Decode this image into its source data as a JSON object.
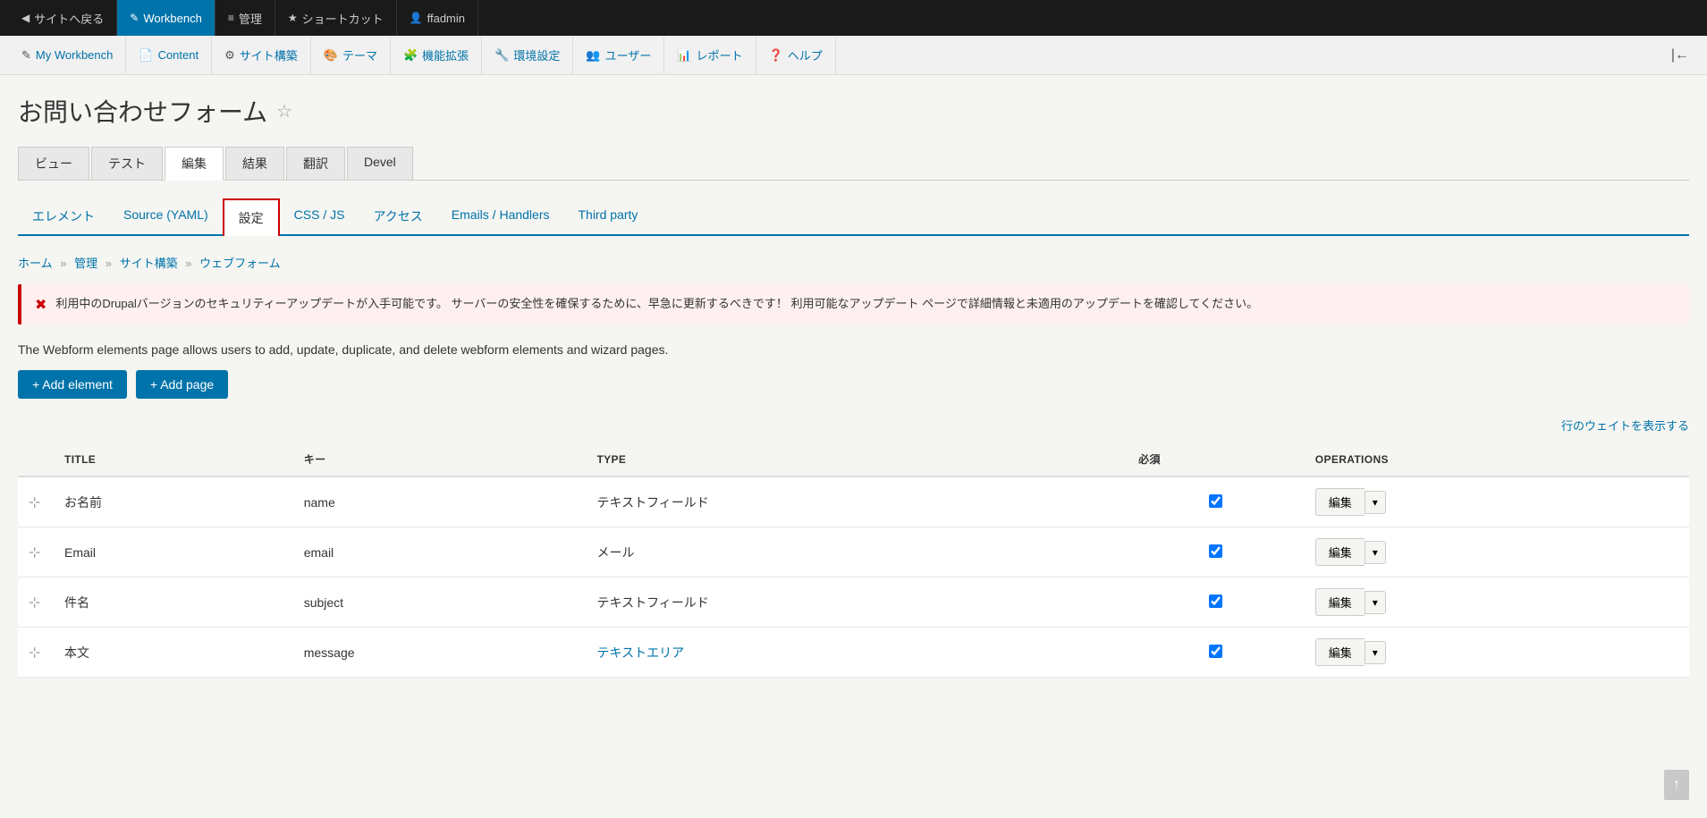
{
  "admin_bar": {
    "items": [
      {
        "id": "back-to-site",
        "label": "サイトへ戻る",
        "icon": "◀"
      },
      {
        "id": "workbench",
        "label": "Workbench",
        "icon": "✎",
        "active": true
      },
      {
        "id": "admin",
        "label": "管理",
        "icon": "≡"
      },
      {
        "id": "shortcuts",
        "label": "ショートカット",
        "icon": "★"
      },
      {
        "id": "user",
        "label": "ffadmin",
        "icon": "👤"
      }
    ]
  },
  "secondary_nav": {
    "items": [
      {
        "id": "my-workbench",
        "label": "My Workbench",
        "icon": "✎"
      },
      {
        "id": "content",
        "label": "Content",
        "icon": "📄"
      },
      {
        "id": "site-structure",
        "label": "サイト構築",
        "icon": "⚙"
      },
      {
        "id": "theme",
        "label": "テーマ",
        "icon": "🔑"
      },
      {
        "id": "extensions",
        "label": "機能拡張",
        "icon": "🧩"
      },
      {
        "id": "environment",
        "label": "環境設定",
        "icon": "🔧"
      },
      {
        "id": "users",
        "label": "ユーザー",
        "icon": "👥"
      },
      {
        "id": "reports",
        "label": "レポート",
        "icon": "📊"
      },
      {
        "id": "help",
        "label": "ヘルプ",
        "icon": "❓"
      }
    ]
  },
  "page": {
    "title": "お問い合わせフォーム",
    "star_tooltip": "お気に入りに追加"
  },
  "primary_tabs": [
    {
      "id": "view",
      "label": "ビュー",
      "active": false
    },
    {
      "id": "test",
      "label": "テスト",
      "active": false
    },
    {
      "id": "edit",
      "label": "編集",
      "active": true
    },
    {
      "id": "results",
      "label": "結果",
      "active": false
    },
    {
      "id": "translate",
      "label": "翻訳",
      "active": false
    },
    {
      "id": "devel",
      "label": "Devel",
      "active": false
    }
  ],
  "secondary_tabs": [
    {
      "id": "elements",
      "label": "エレメント",
      "active": false
    },
    {
      "id": "source-yaml",
      "label": "Source (YAML)",
      "active": false
    },
    {
      "id": "settings",
      "label": "設定",
      "active": true
    },
    {
      "id": "css-js",
      "label": "CSS / JS",
      "active": false
    },
    {
      "id": "access",
      "label": "アクセス",
      "active": false
    },
    {
      "id": "emails-handlers",
      "label": "Emails / Handlers",
      "active": false
    },
    {
      "id": "third-party",
      "label": "Third party",
      "active": false
    }
  ],
  "breadcrumb": {
    "items": [
      {
        "label": "ホーム",
        "href": "#"
      },
      {
        "label": "管理",
        "href": "#"
      },
      {
        "label": "サイト構築",
        "href": "#"
      },
      {
        "label": "ウェブフォーム",
        "href": "#"
      }
    ]
  },
  "alert": {
    "text": "利用中のDrupalバージョンのセキュリティーアップデートが入手可能です。 サーバーの安全性を確保するために、早急に更新するべきです！ 利用可能なアップデート ページで詳細情報と未適用のアップデートを確認してください。"
  },
  "description": "The Webform elements page allows users to add, update, duplicate, and delete webform elements and wizard pages.",
  "buttons": {
    "add_element": "+ Add element",
    "add_page": "+ Add page"
  },
  "show_weights_link": "行のウェイトを表示する",
  "table": {
    "columns": [
      {
        "id": "title",
        "label": "TITLE"
      },
      {
        "id": "key",
        "label": "キー"
      },
      {
        "id": "type",
        "label": "TYPE"
      },
      {
        "id": "required",
        "label": "必須"
      },
      {
        "id": "operations",
        "label": "OPERATIONS"
      }
    ],
    "rows": [
      {
        "id": "name-row",
        "title": "お名前",
        "key": "name",
        "type": "テキストフィールド",
        "type_is_link": false,
        "required": true,
        "edit_label": "編集"
      },
      {
        "id": "email-row",
        "title": "Email",
        "key": "email",
        "type": "メール",
        "type_is_link": false,
        "required": true,
        "edit_label": "編集"
      },
      {
        "id": "subject-row",
        "title": "件名",
        "key": "subject",
        "type": "テキストフィールド",
        "type_is_link": false,
        "required": true,
        "edit_label": "編集"
      },
      {
        "id": "message-row",
        "title": "本文",
        "key": "message",
        "type": "テキストエリア",
        "type_is_link": true,
        "required": true,
        "edit_label": "編集"
      }
    ]
  }
}
